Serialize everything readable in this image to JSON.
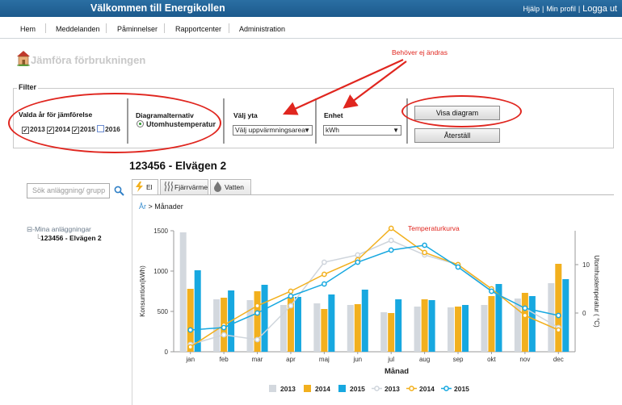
{
  "header": {
    "app_title": "Välkommen till Energikollen",
    "links": [
      "Hjälp",
      "Min profil",
      "Logga ut"
    ],
    "separator": "|"
  },
  "menu": [
    "Hem",
    "Meddelanden",
    "Påminnelser",
    "Rapportcenter",
    "Administration"
  ],
  "page": {
    "title": "Jämföra förbrukningen",
    "note": "Behöver ej ändras"
  },
  "filter": {
    "legend": "Filter",
    "years_label": "Valda år för jämförelse",
    "years": [
      {
        "label": "2013",
        "checked": true
      },
      {
        "label": "2014",
        "checked": true
      },
      {
        "label": "2015",
        "checked": true
      },
      {
        "label": "2016",
        "checked": false
      }
    ],
    "alt_label": "Diagramalternativ",
    "alt_option": "Utomhustemperatur",
    "area_label": "Välj yta",
    "area_value": "Välj uppvärmningsarea",
    "unit_label": "Enhet",
    "unit_value": "kWh",
    "show_button": "Visa diagram",
    "reset_button": "Återställ"
  },
  "sidebar": {
    "search_placeholder": "Sök anläggning/ grupp",
    "tree_root": "Mina anläggningar",
    "tree_child": "123456 - Elvägen 2"
  },
  "main": {
    "property_title": "123456 - Elvägen 2",
    "tabs": [
      "El",
      "Fjärrvärme",
      "Vatten"
    ],
    "breadcrumb_link": "År",
    "breadcrumb_current": "Månader"
  },
  "chart_data": {
    "type": "bar",
    "categories": [
      "jan",
      "feb",
      "mar",
      "apr",
      "maj",
      "jun",
      "jul",
      "aug",
      "sep",
      "okt",
      "nov",
      "dec"
    ],
    "xlabel": "Månad",
    "ylabel": "Konsumtion(kWh)",
    "y2label": "Utomhustemperatur ( °C)",
    "ylim": [
      0,
      1500
    ],
    "yticks": [
      0,
      500,
      1000,
      1500
    ],
    "y2lim": [
      -8,
      17
    ],
    "y2ticks": [
      0,
      10
    ],
    "annotation": "Temperaturkurva",
    "legend_position": "bottom",
    "series": [
      {
        "name": "2013",
        "kind": "bar",
        "color": "#d3d8de",
        "values": [
          1480,
          650,
          640,
          580,
          600,
          580,
          490,
          560,
          550,
          580,
          660,
          850
        ]
      },
      {
        "name": "2014",
        "kind": "bar",
        "color": "#f2b01e",
        "values": [
          780,
          670,
          750,
          680,
          530,
          590,
          480,
          650,
          560,
          690,
          730,
          1090
        ]
      },
      {
        "name": "2015",
        "kind": "bar",
        "color": "#17a8e0",
        "values": [
          1010,
          760,
          830,
          680,
          710,
          770,
          650,
          640,
          580,
          840,
          690,
          900
        ]
      },
      {
        "name": "2013",
        "kind": "line",
        "color": "#cfd5dc",
        "values": [
          -6.5,
          -4.5,
          -5.5,
          1.5,
          10.5,
          12,
          15,
          12,
          10,
          4.5,
          1,
          -3
        ]
      },
      {
        "name": "2014",
        "kind": "line",
        "color": "#f2b01e",
        "values": [
          -7,
          -2.5,
          1.5,
          4.5,
          8,
          11,
          17.5,
          12.5,
          10,
          5,
          -0.5,
          -3.5
        ]
      },
      {
        "name": "2015",
        "kind": "line",
        "color": "#17a8e0",
        "values": [
          -3.5,
          -3,
          0,
          3.5,
          6,
          10.5,
          13,
          14,
          9.5,
          4.5,
          1,
          -0.5
        ]
      }
    ]
  }
}
